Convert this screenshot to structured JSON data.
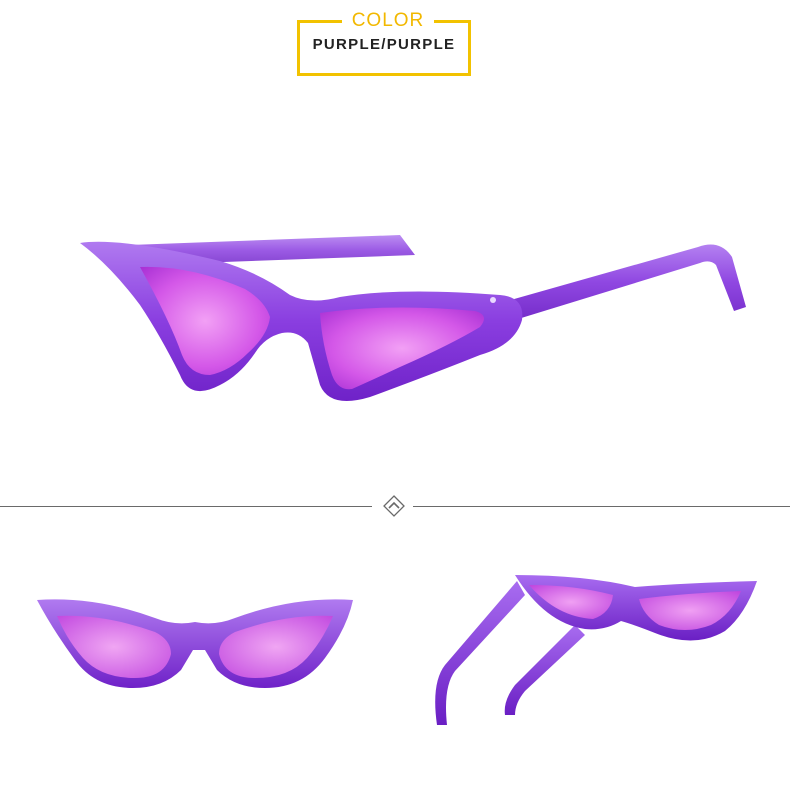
{
  "color_label": {
    "heading": "COLOR",
    "value": "PURPLE/PURPLE"
  },
  "colors": {
    "accent_yellow": "#f2c200",
    "frame_purple": "#8a3ee0",
    "lens_pink": "#d04fe6",
    "divider": "#6a6a6a"
  },
  "divider_icon": "chevron-up-diamond-icon"
}
